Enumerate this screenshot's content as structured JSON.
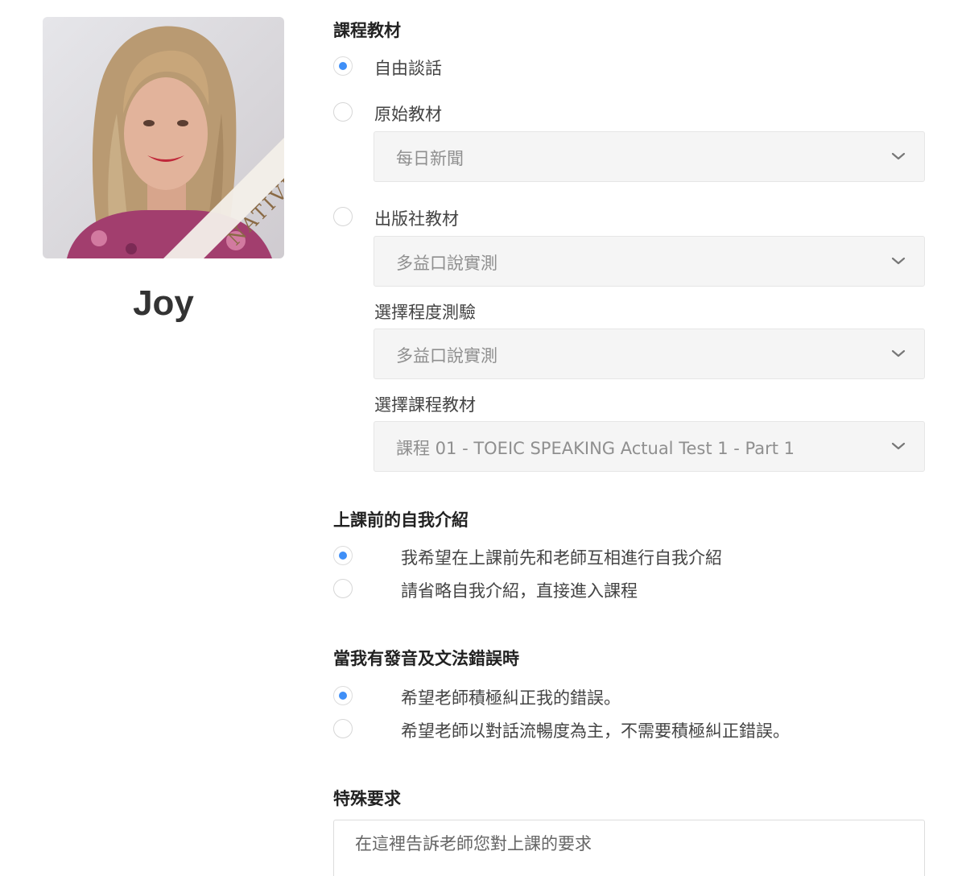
{
  "teacher": {
    "name": "Joy",
    "badge": "NATIVE"
  },
  "material": {
    "title": "課程教材",
    "options": [
      {
        "label": "自由談話",
        "checked": true
      },
      {
        "label": "原始教材",
        "checked": false
      },
      {
        "label": "出版社教材",
        "checked": false
      }
    ],
    "original_select_value": "每日新聞",
    "publisher_select_value": "多益口說實測",
    "level_test_label": "選擇程度測驗",
    "level_test_value": "多益口說實測",
    "course_material_label": "選擇課程教材",
    "course_material_value": "課程 01 - TOEIC SPEAKING Actual Test 1 - Part 1"
  },
  "intro": {
    "title": "上課前的自我介紹",
    "options": [
      {
        "label": "我希望在上課前先和老師互相進行自我介紹",
        "checked": true
      },
      {
        "label": "請省略自我介紹，直接進入課程",
        "checked": false
      }
    ]
  },
  "correction": {
    "title": "當我有發音及文法錯誤時",
    "options": [
      {
        "label": "希望老師積極糾正我的錯誤。",
        "checked": true
      },
      {
        "label": "希望老師以對話流暢度為主，不需要積極糾正錯誤。",
        "checked": false
      }
    ]
  },
  "special": {
    "title": "特殊要求",
    "placeholder": "在這裡告訴老師您對上課的要求"
  },
  "colors": {
    "accent": "#3f8ff7",
    "select_bg": "#f5f5f5",
    "text": "#333333"
  }
}
